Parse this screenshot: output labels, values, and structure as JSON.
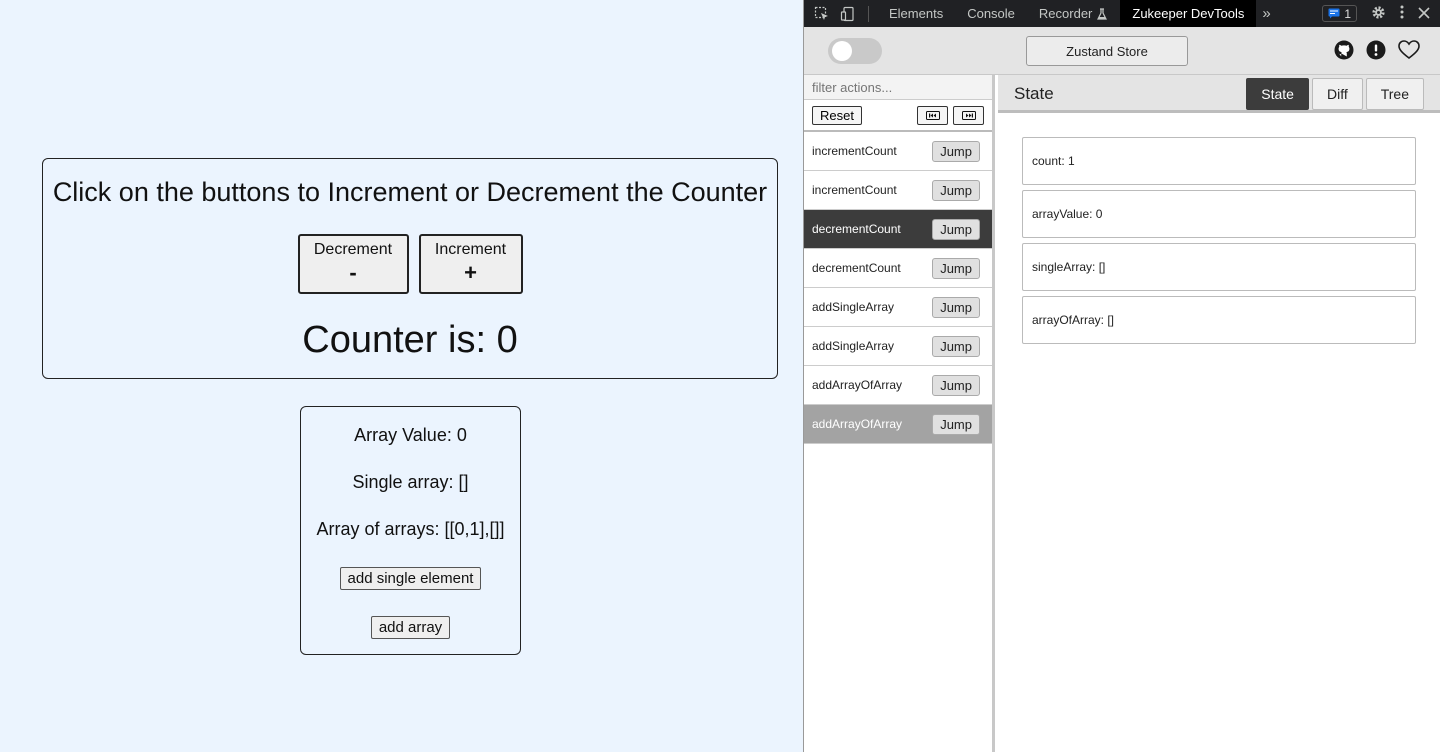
{
  "app": {
    "heading": "Click on the buttons to Increment or Decrement the Counter",
    "decrement": {
      "label": "Decrement",
      "symbol": "-"
    },
    "increment": {
      "label": "Increment",
      "symbol": "+"
    },
    "counter_text": "Counter is: 0",
    "array_value_text": "Array Value: 0",
    "single_array_text": "Single array: []",
    "array_of_arrays_text": "Array of arrays: [[0,1],[]]",
    "add_single_button": "add single element",
    "add_array_button": "add array"
  },
  "devtools": {
    "tabs": [
      "Elements",
      "Console",
      "Recorder",
      "Zukeeper DevTools"
    ],
    "recorder_icon": "flask-icon",
    "more_tabs": "»",
    "message_count": "1",
    "store_button": "Zustand Store",
    "filter_placeholder": "filter actions...",
    "reset_label": "Reset",
    "jump_label": "Jump",
    "actions": [
      {
        "name": "incrementCount",
        "style": "normal"
      },
      {
        "name": "incrementCount",
        "style": "normal"
      },
      {
        "name": "decrementCount",
        "style": "dark"
      },
      {
        "name": "decrementCount",
        "style": "normal"
      },
      {
        "name": "addSingleArray",
        "style": "normal"
      },
      {
        "name": "addSingleArray",
        "style": "normal"
      },
      {
        "name": "addArrayOfArray",
        "style": "normal"
      },
      {
        "name": "addArrayOfArray",
        "style": "grey"
      }
    ],
    "state_title": "State",
    "view_tabs": [
      "State",
      "Diff",
      "Tree"
    ],
    "active_view": "State",
    "state_items": [
      "count: 1",
      "arrayValue: 0",
      "singleArray: []",
      "arrayOfArray: []"
    ]
  }
}
